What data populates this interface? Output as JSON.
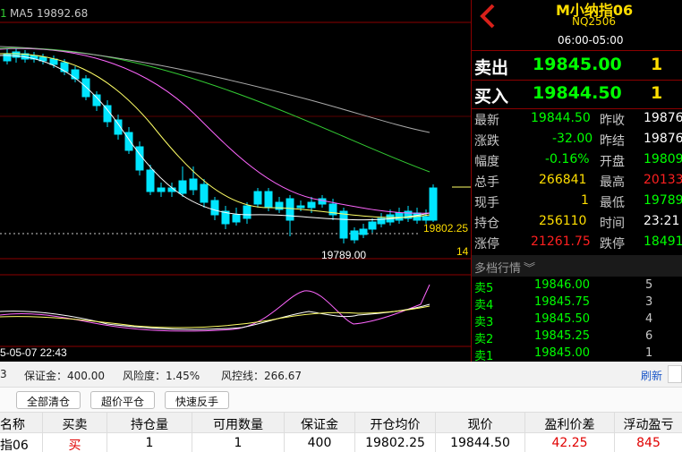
{
  "chart": {
    "ma5_label": "MA5 19892.68",
    "ma_prefix": "1",
    "sub_label": "14",
    "last_price_label": "19802.25",
    "low_label": "19789.00",
    "date_label": "5-05-07 22:43",
    "colors": {
      "up": "#ff3b3b",
      "down": "#00e5ff",
      "ma5": "#ffffff",
      "ma10": "#ffff66",
      "ma20": "#ff66ff",
      "ma40": "#33cc33",
      "ma60": "#aaaaaa"
    }
  },
  "quote": {
    "name": "M小纳指06",
    "code": "NQ2506",
    "hours": "06:00-05:00",
    "ask_label": "卖出",
    "ask_price": "19845.00",
    "ask_vol": "1",
    "bid_label": "买入",
    "bid_price": "19844.50",
    "bid_vol": "1",
    "stats": [
      {
        "l1": "最新",
        "v1": "19844.50",
        "l2": "昨收",
        "v2": "19876"
      },
      {
        "l1": "涨跌",
        "v1": "-32.00",
        "l2": "昨结",
        "v2": "19876"
      },
      {
        "l1": "幅度",
        "v1": "-0.16%",
        "l2": "开盘",
        "v2": "19809"
      },
      {
        "l1": "总手",
        "v1": "266841",
        "l2": "最高",
        "v2": "20133"
      },
      {
        "l1": "现手",
        "v1": "1",
        "l2": "最低",
        "v2": "19789"
      },
      {
        "l1": "持仓",
        "v1": "256110",
        "l2": "时间",
        "v2": "23:21"
      },
      {
        "l1": "涨停",
        "v1": "21261.75",
        "l2": "跌停",
        "v2": "18491"
      }
    ],
    "depth_title": "多档行情",
    "depth": [
      {
        "label": "卖5",
        "price": "19846.00",
        "vol": "5"
      },
      {
        "label": "卖4",
        "price": "19845.75",
        "vol": "3"
      },
      {
        "label": "卖3",
        "price": "19845.50",
        "vol": "4"
      },
      {
        "label": "卖2",
        "price": "19845.25",
        "vol": "6"
      },
      {
        "label": "卖1",
        "price": "19845.00",
        "vol": "1"
      }
    ]
  },
  "account": {
    "first": "3",
    "margin": "保证金：400.00",
    "risk": "风险度：1.45%",
    "control": "风控线：266.67",
    "refresh": "刷新"
  },
  "buttons": {
    "close_all": "全部清仓",
    "over_price": "超价平仓",
    "reverse": "快速反手"
  },
  "table": {
    "headers": [
      "名称",
      "买卖",
      "持仓量",
      "可用数量",
      "保证金",
      "开仓均价",
      "现价",
      "盈利价差",
      "浮动盈亏"
    ],
    "row": [
      "指06",
      "买",
      "1",
      "1",
      "400",
      "19802.25",
      "19844.50",
      "42.25",
      "845"
    ]
  }
}
